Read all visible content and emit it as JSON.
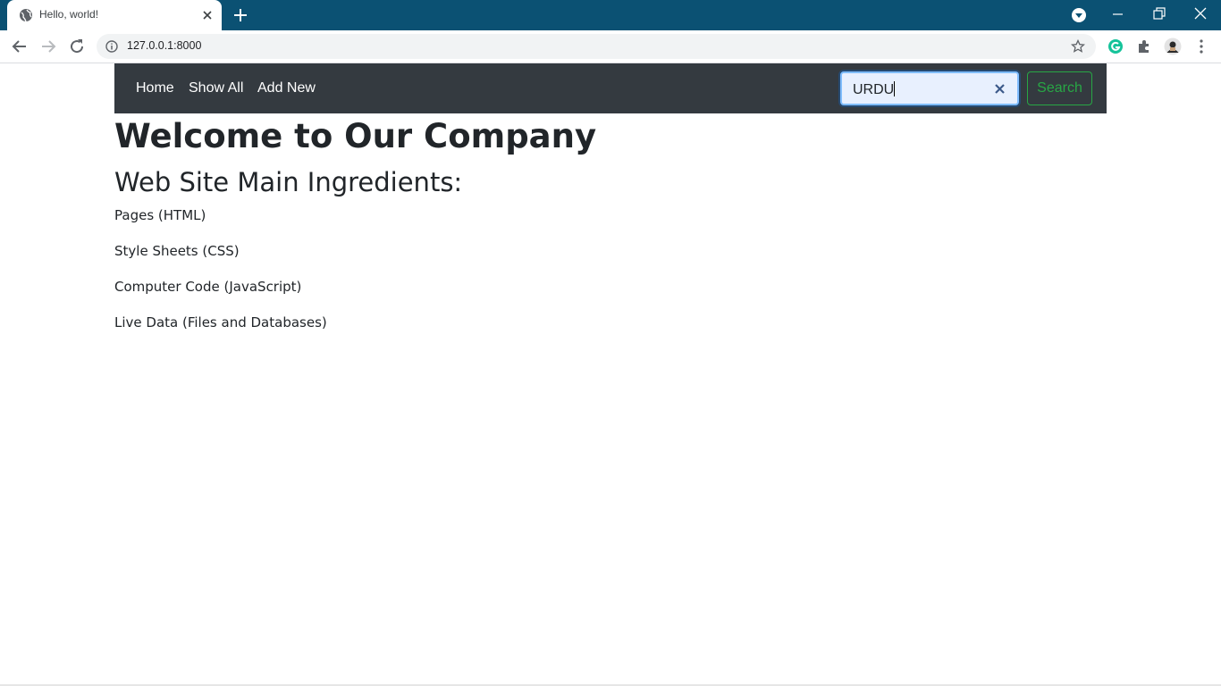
{
  "browser": {
    "tab_title": "Hello, world!",
    "url": "127.0.0.1:8000",
    "titlebar_color": "#0b5173"
  },
  "navbar": {
    "links": [
      {
        "label": "Home"
      },
      {
        "label": "Show All"
      },
      {
        "label": "Add New"
      }
    ],
    "search": {
      "value": "URDU",
      "button_label": "Search"
    },
    "background_color": "#343a40",
    "search_button_color": "#28a745"
  },
  "main": {
    "title": "Welcome to Our Company",
    "subtitle": "Web Site Main Ingredients:",
    "ingredients": [
      "Pages (HTML)",
      "Style Sheets (CSS)",
      "Computer Code (JavaScript)",
      "Live Data (Files and Databases)"
    ]
  },
  "icons": [
    "globe-icon",
    "close-icon",
    "plus-icon",
    "tab-search-icon",
    "minimize-icon",
    "restore-icon",
    "window-close-icon",
    "back-icon",
    "forward-icon",
    "reload-icon",
    "info-icon",
    "star-icon",
    "grammarly-icon",
    "extensions-icon",
    "profile-avatar-icon",
    "menu-icon"
  ]
}
